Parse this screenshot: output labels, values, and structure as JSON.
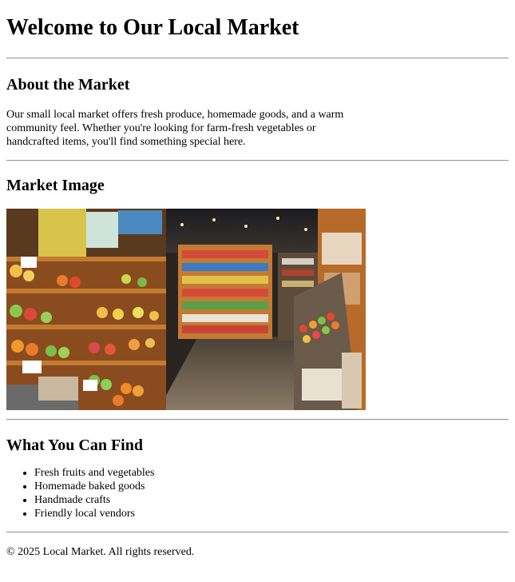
{
  "header": {
    "title": "Welcome to Our Local Market"
  },
  "about": {
    "heading": "About the Market",
    "text": "Our small local market offers fresh produce, homemade goods, and a warm community feel. Whether you're looking for farm-fresh vegetables or handcrafted items, you'll find something special here."
  },
  "image_section": {
    "heading": "Market Image"
  },
  "find": {
    "heading": "What You Can Find",
    "items": [
      "Fresh fruits and vegetables",
      "Homemade baked goods",
      "Handmade crafts",
      "Friendly local vendors"
    ]
  },
  "footer": {
    "text": "© 2025 Local Market. All rights reserved."
  }
}
